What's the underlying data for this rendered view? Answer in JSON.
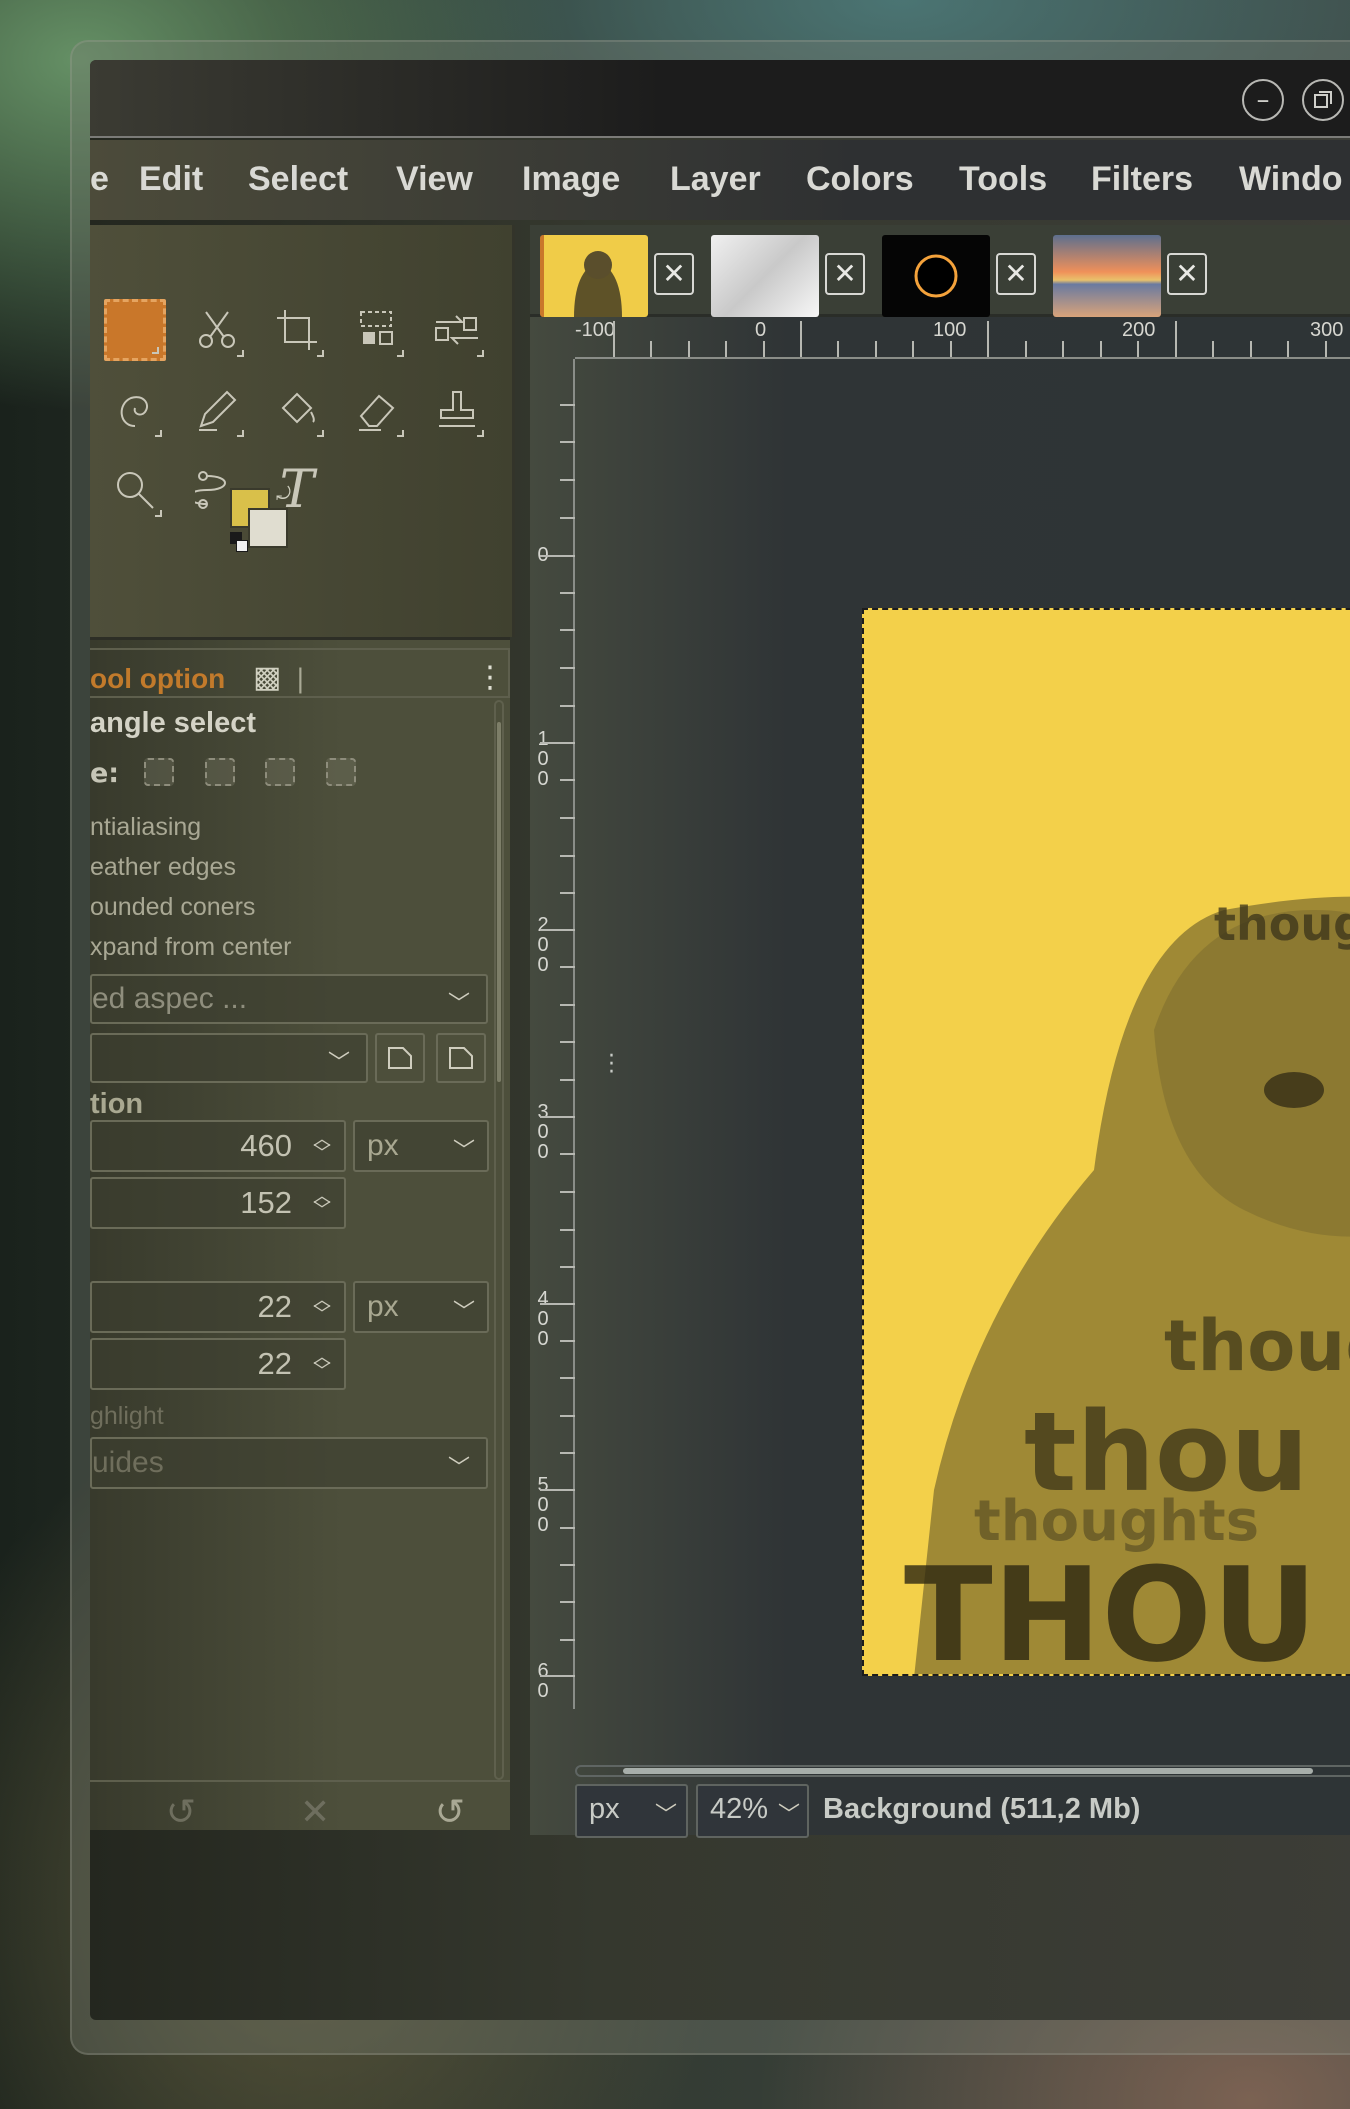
{
  "window": {
    "minimize_icon": "minimize-circle",
    "restore_icon": "restore-circle"
  },
  "menubar": {
    "items": [
      "e",
      "Edit",
      "Select",
      "View",
      "Image",
      "Layer",
      "Colors",
      "Tools",
      "Filters",
      "Windo"
    ]
  },
  "toolbox": {
    "tools": [
      {
        "name": "rectangle-select",
        "icon": "rect-select-icon",
        "active": true
      },
      {
        "name": "scissors",
        "icon": "scissors-icon"
      },
      {
        "name": "crop",
        "icon": "crop-icon"
      },
      {
        "name": "align",
        "icon": "align-icon"
      },
      {
        "name": "transform",
        "icon": "transform-icon"
      },
      {
        "name": "warp",
        "icon": "warp-icon"
      },
      {
        "name": "pencil",
        "icon": "pencil-icon"
      },
      {
        "name": "bucket-fill",
        "icon": "bucket-icon"
      },
      {
        "name": "eraser",
        "icon": "eraser-icon"
      },
      {
        "name": "clone",
        "icon": "stamp-icon"
      },
      {
        "name": "zoom",
        "icon": "magnifier-icon"
      },
      {
        "name": "paths",
        "icon": "paths-icon"
      },
      {
        "name": "text",
        "icon": "text-icon",
        "glyph": "T"
      }
    ],
    "fg_color": "#d9c04a",
    "bg_color": "#e0ddd0"
  },
  "tool_options": {
    "tab_title": "ool option",
    "heading": "angle select",
    "mode_label": "e:",
    "checkboxes": [
      "ntialiasing",
      "eather edges",
      "ounded coners",
      "xpand from center"
    ],
    "fixed_aspect": "ed aspec ...",
    "position_label": "tion",
    "pos_x": "460",
    "pos_y": "152",
    "pos_unit": "px",
    "size_w": "22",
    "size_h": "22",
    "size_unit": "px",
    "highlight_label": "ghlight",
    "guides_value": "uides"
  },
  "image_tabs": [
    {
      "name": "gorilla",
      "active": true
    },
    {
      "name": "white-abstract"
    },
    {
      "name": "eclipse"
    },
    {
      "name": "sunset"
    }
  ],
  "rulers": {
    "h_labels": [
      "-100",
      "0",
      "100",
      "200",
      "300"
    ],
    "v_labels": [
      "0",
      "1\n0\n0",
      "2\n0\n0",
      "3\n0\n0",
      "4\n0\n0",
      "5\n0\n0",
      "6\n0"
    ]
  },
  "status": {
    "unit": "px",
    "zoom": "42%",
    "layer_info": "Background (511,2 Mb)"
  },
  "canvas": {
    "artwork_words": [
      "thoughts",
      "though",
      "thou",
      "THOU",
      "thoughts"
    ]
  }
}
